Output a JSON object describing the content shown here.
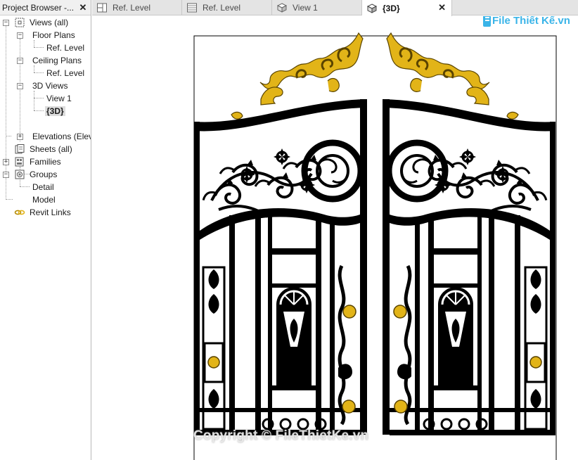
{
  "browser": {
    "title": "Project Browser -...",
    "close_glyph": "✕",
    "tree": [
      {
        "id": "views-all",
        "label": "Views (all)",
        "icon": "views-icon",
        "expander": "−"
      },
      {
        "id": "floor-plans",
        "label": "Floor Plans",
        "expander": "−"
      },
      {
        "id": "floor-ref-level",
        "label": "Ref. Level"
      },
      {
        "id": "ceiling-plans",
        "label": "Ceiling Plans",
        "expander": "−"
      },
      {
        "id": "ceiling-ref-level",
        "label": "Ref. Level"
      },
      {
        "id": "3d-views",
        "label": "3D Views",
        "expander": "−"
      },
      {
        "id": "view-1",
        "label": "View 1"
      },
      {
        "id": "3d",
        "label": "{3D}",
        "selected": true
      },
      {
        "id": "elevations",
        "label": "Elevations (Elev",
        "expander": "+"
      },
      {
        "id": "sheets-all",
        "label": "Sheets (all)",
        "icon": "sheets-icon"
      },
      {
        "id": "families",
        "label": "Families",
        "icon": "families-icon",
        "expander": "+"
      },
      {
        "id": "groups",
        "label": "Groups",
        "icon": "groups-icon",
        "expander": "−"
      },
      {
        "id": "detail",
        "label": "Detail"
      },
      {
        "id": "model",
        "label": "Model"
      },
      {
        "id": "revit-links",
        "label": "Revit Links",
        "icon": "link-icon"
      }
    ]
  },
  "tabs": [
    {
      "label": "Ref. Level",
      "icon": "floor-plan-icon",
      "active": false
    },
    {
      "label": "Ref. Level",
      "icon": "ceiling-plan-icon",
      "active": false
    },
    {
      "label": "View 1",
      "icon": "3d-view-icon",
      "active": false
    },
    {
      "label": "{3D}",
      "icon": "3d-view-icon",
      "active": true,
      "close_glyph": "✕"
    }
  ],
  "watermark": {
    "logo_text": "File Thiết Kế.vn",
    "copyright": "Copyright © FileThietKe.vn"
  },
  "colors": {
    "iron": "#000000",
    "gold": "#e2b418",
    "gold_outline": "#5a4400"
  }
}
